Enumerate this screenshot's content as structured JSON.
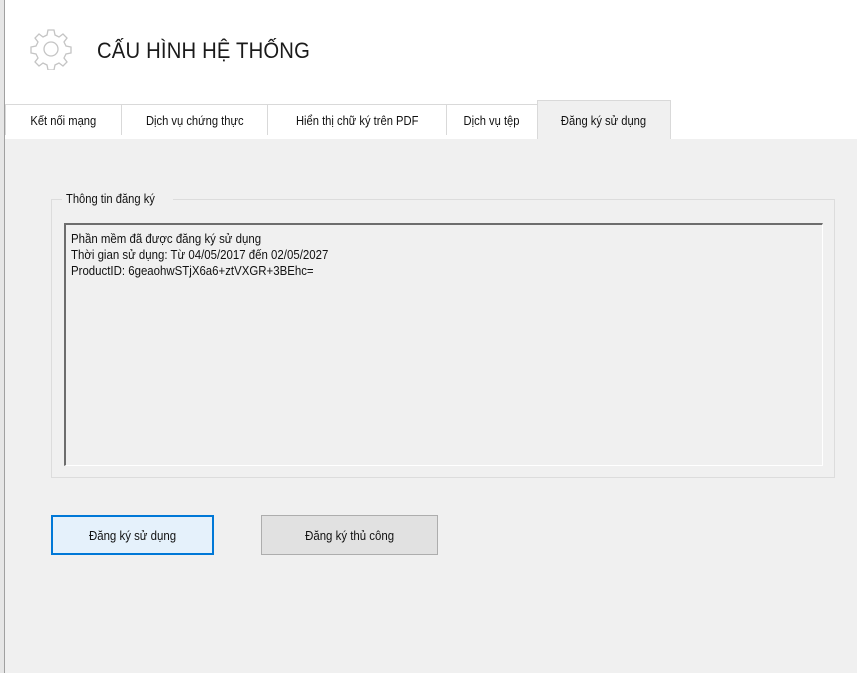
{
  "header": {
    "title": "CẤU HÌNH HỆ THỐNG",
    "icon": "gear-icon"
  },
  "tabs": [
    {
      "label": "Kết nối mạng",
      "active": false
    },
    {
      "label": "Dịch vụ chứng thực",
      "active": false
    },
    {
      "label": "Hiển thị chữ ký trên PDF",
      "active": false
    },
    {
      "label": "Dịch vụ tệp",
      "active": false
    },
    {
      "label": "Đăng ký sử dụng",
      "active": true
    }
  ],
  "registration": {
    "group_label": "Thông tin đăng ký",
    "lines": [
      "Phần mềm đã được đăng ký sử dụng",
      "Thời gian sử dụng: Từ 04/05/2017 đến 02/05/2027",
      "ProductID: 6geaohwSTjX6a6+ztVXGR+3BEhc="
    ]
  },
  "buttons": {
    "register": "Đăng ký sử dụng",
    "manual_register": "Đăng ký thủ công"
  },
  "colors": {
    "accent": "#0078d7",
    "window_bg": "#f0f0f0",
    "header_bg": "#ffffff"
  }
}
